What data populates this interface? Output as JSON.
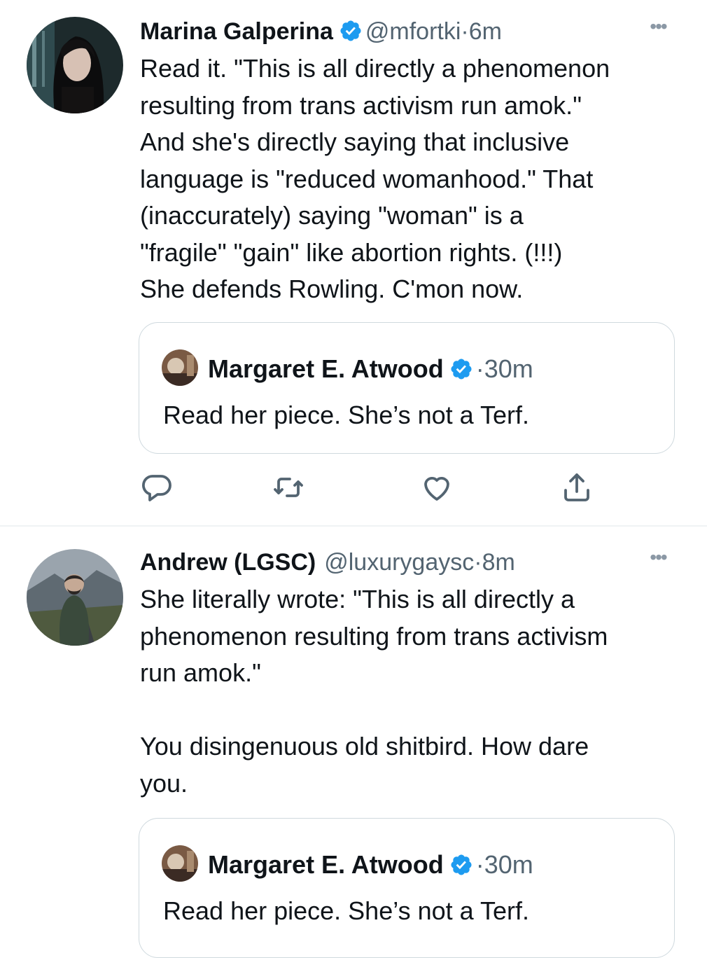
{
  "tweets": [
    {
      "author": "Marina Galperina",
      "handle": "@mfortki",
      "separator": "·",
      "time": "6m",
      "more_icon": "more-horizontal-icon",
      "text": "Read it. \"This is all directly a phenomenon\nresulting from trans activism run amok.\"\nAnd she's directly saying that inclusive\nlanguage is \"reduced womanhood.\" That\n(inaccurately) saying \"woman\" is a\n\"fragile\" \"gain\" like abortion rights. (!!!)\nShe defends Rowling. C'mon now.",
      "quote": {
        "author": "Margaret E. Atwood",
        "separator": "·",
        "time": "30m",
        "text": "Read her piece. She’s not a Terf."
      },
      "actions": [
        "reply-icon",
        "retweet-icon",
        "like-icon",
        "share-icon"
      ]
    },
    {
      "author": "Andrew (LGSC)",
      "handle": "@luxurygaysc",
      "separator": "·",
      "time": "8m",
      "more_icon": "more-horizontal-icon",
      "text": "She literally wrote: \"This is all directly a\nphenomenon resulting from trans activism\nrun amok.\"\n\nYou disingenuous old shitbird. How dare\nyou.",
      "quote": {
        "author": "Margaret E. Atwood",
        "separator": "·",
        "time": "30m",
        "text": "Read her piece. She’s not a Terf."
      }
    }
  ],
  "colors": {
    "text_primary": "#0f1419",
    "text_secondary": "#536471",
    "verified_blue": "#1d9bf0",
    "border": "#cfd9de"
  }
}
